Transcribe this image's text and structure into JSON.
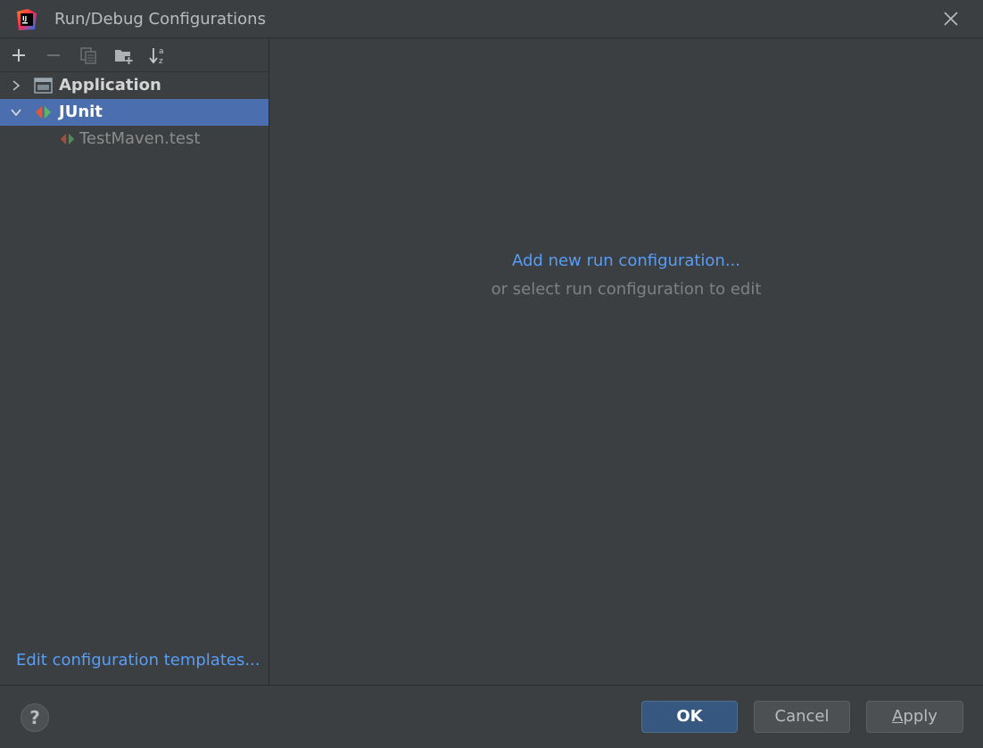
{
  "window": {
    "title": "Run/Debug Configurations",
    "icons": {
      "app": "intellij-idea-icon",
      "close": "close-icon"
    }
  },
  "toolbar": {
    "buttons": [
      {
        "name": "add",
        "icon": "plus-icon"
      },
      {
        "name": "remove",
        "icon": "minus-icon"
      },
      {
        "name": "copy",
        "icon": "copy-icon"
      },
      {
        "name": "new-folder",
        "icon": "folder-add-icon"
      },
      {
        "name": "sort",
        "icon": "sort-alpha-icon"
      }
    ]
  },
  "tree": {
    "items": [
      {
        "label": "Application",
        "expanded": false,
        "selected": false,
        "icon": "application-icon",
        "level": 0
      },
      {
        "label": "JUnit",
        "expanded": true,
        "selected": true,
        "icon": "junit-icon",
        "level": 0
      },
      {
        "label": "TestMaven.test",
        "selected": false,
        "icon": "junit-test-icon",
        "level": 1
      }
    ]
  },
  "templates_link": "Edit configuration templates...",
  "main": {
    "add_link": "Add new run configuration...",
    "hint": "or select run configuration to edit"
  },
  "footer": {
    "help": "?",
    "ok": "OK",
    "cancel": "Cancel",
    "apply_mnemonic": "A",
    "apply_rest": "pply"
  },
  "colors": {
    "background": "#3c3f41",
    "selection": "#4b6eaf",
    "link": "#589df6",
    "hint": "#808080",
    "primary_button": "#365880",
    "junit_red": "#e0583a",
    "junit_green": "#5eb46a"
  }
}
